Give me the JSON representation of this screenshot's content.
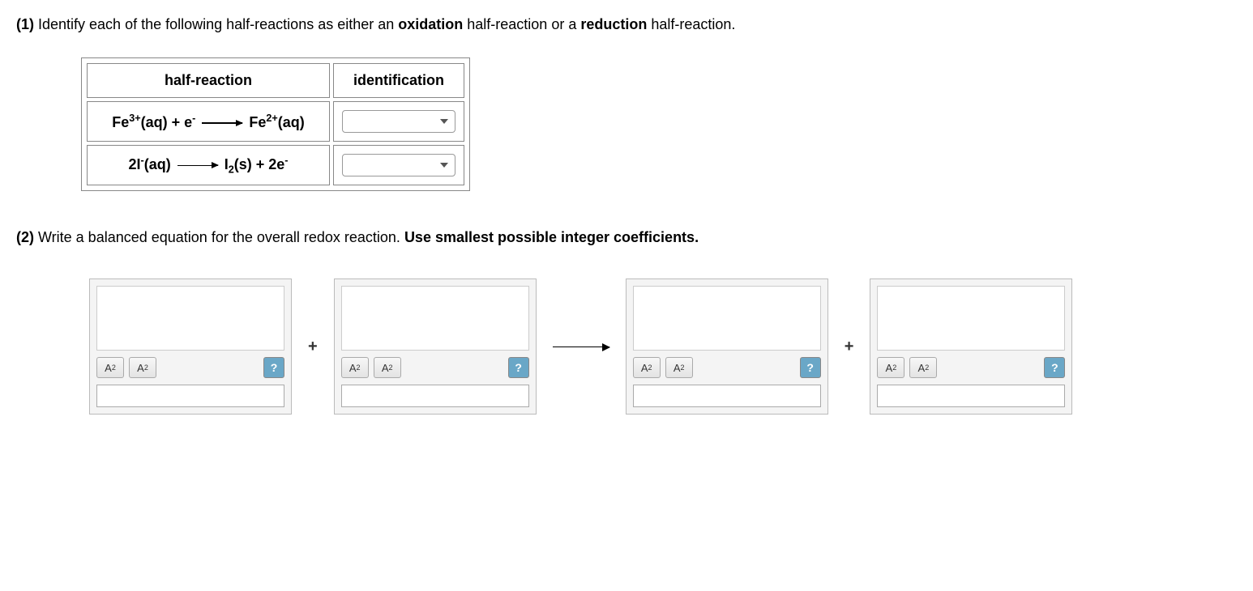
{
  "q1": {
    "number": "(1)",
    "prompt_before": " Identify each of the following half-reactions as either an ",
    "bold1": "oxidation",
    "prompt_mid": " half-reaction or a ",
    "bold2": "reduction",
    "prompt_after": " half-reaction.",
    "headers": {
      "col1": "half-reaction",
      "col2": "identification"
    },
    "rows": [
      {
        "parts": {
          "p1": "Fe",
          "sup1": "3+",
          "p2": "(aq) + e",
          "sup2": "-",
          "p3": " ",
          "p4": " Fe",
          "sup3": "2+",
          "p5": "(aq)"
        }
      },
      {
        "parts": {
          "p1": "2I",
          "sup1": "-",
          "p2": "(aq) ",
          "p3": " I",
          "sub1": "2",
          "p4": "(s) + 2e",
          "sup2": "-"
        }
      }
    ]
  },
  "q2": {
    "number": "(2)",
    "prompt_a": " Write a balanced equation for the overall redox reaction. ",
    "prompt_bold": "Use smallest possible integer coefficients.",
    "sub_btn": {
      "a": "A",
      "s": "2"
    },
    "sup_btn": {
      "a": "A",
      "s": "2"
    },
    "help": "?",
    "plus": "+"
  }
}
